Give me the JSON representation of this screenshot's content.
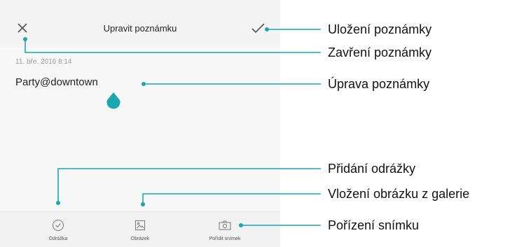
{
  "screen": {
    "title": "Upravit poznámku",
    "timestamp": "11. bře. 2016 8:14",
    "note_text": "Party@downtown",
    "toolbar": [
      {
        "label": "Odrážka",
        "icon": "checklist-icon"
      },
      {
        "label": "Obrázek",
        "icon": "image-icon"
      },
      {
        "label": "Pořídit snímek",
        "icon": "camera-icon"
      }
    ]
  },
  "callouts": {
    "save": "Uložení poznámky",
    "close": "Zavření poznámky",
    "edit": "Úprava poznámky",
    "bullet": "Přidání odrážky",
    "gallery": "Vložení obrázku z galerie",
    "photo": "Pořízení snímku"
  },
  "colors": {
    "accent": "#1aa6b3",
    "icon": "#777777"
  }
}
